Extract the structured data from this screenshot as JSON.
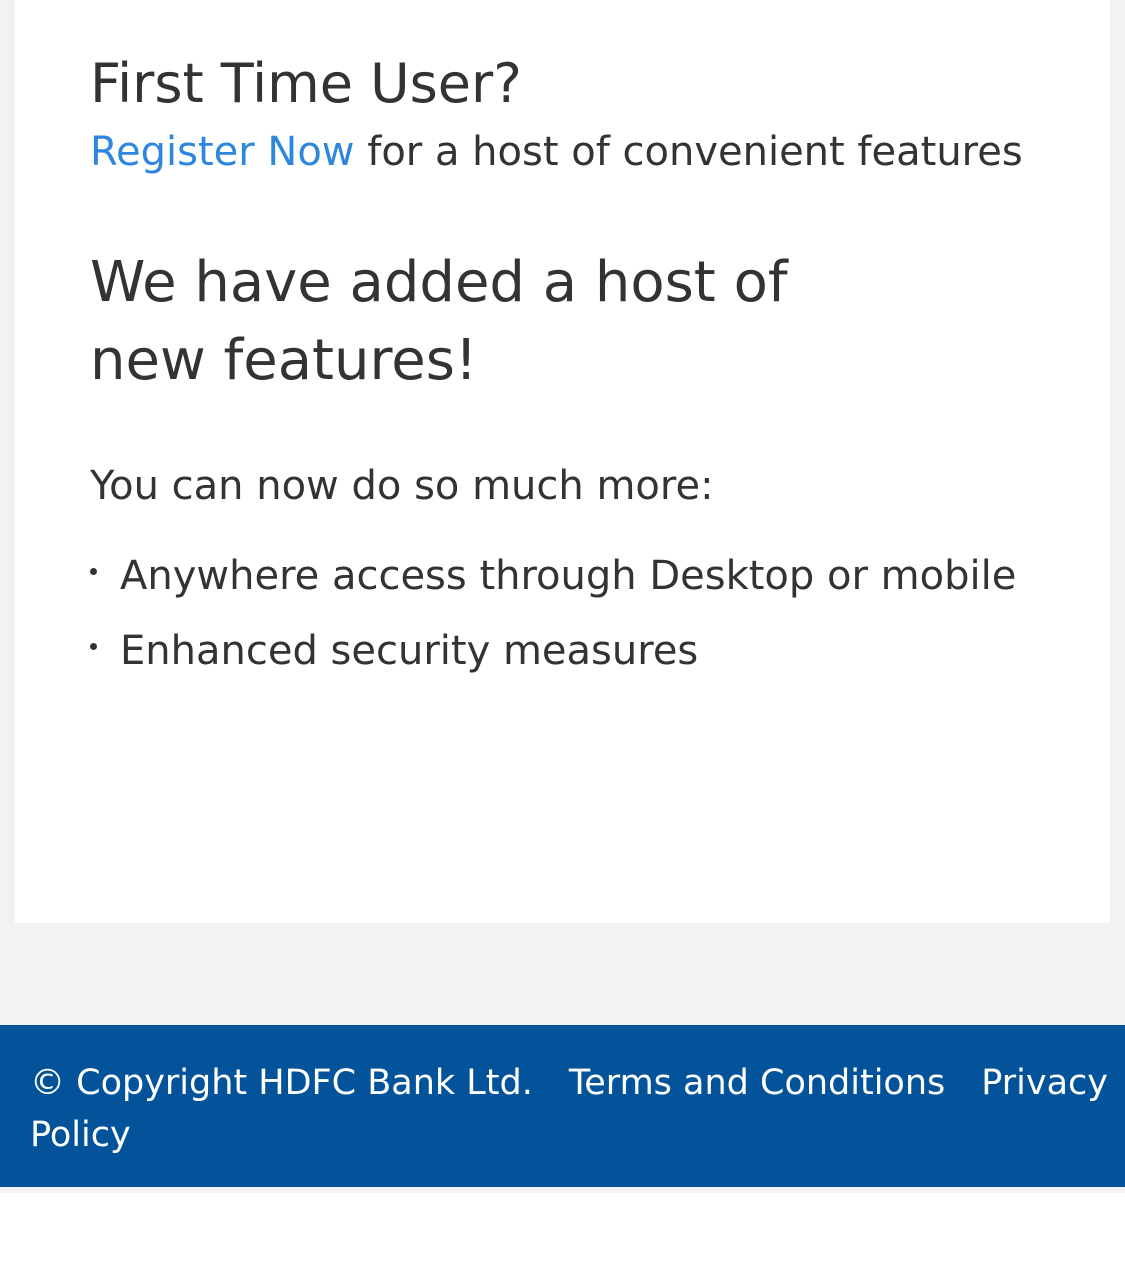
{
  "register_section": {
    "title": "First Time User?",
    "register_link": "Register Now",
    "register_suffix": " for a host of convenient features",
    "link_color": "#2e86de"
  },
  "features_section": {
    "heading": "We have added a host of new features!",
    "intro": "You can now do so much more:",
    "items": [
      "Anywhere access through Desktop or mobile",
      "Enhanced security measures"
    ]
  },
  "footer": {
    "copyright": "© Copyright HDFC Bank Ltd.",
    "terms_link": "Terms and Conditions",
    "privacy_link": "Privacy Policy",
    "background_color": "#03539b"
  }
}
